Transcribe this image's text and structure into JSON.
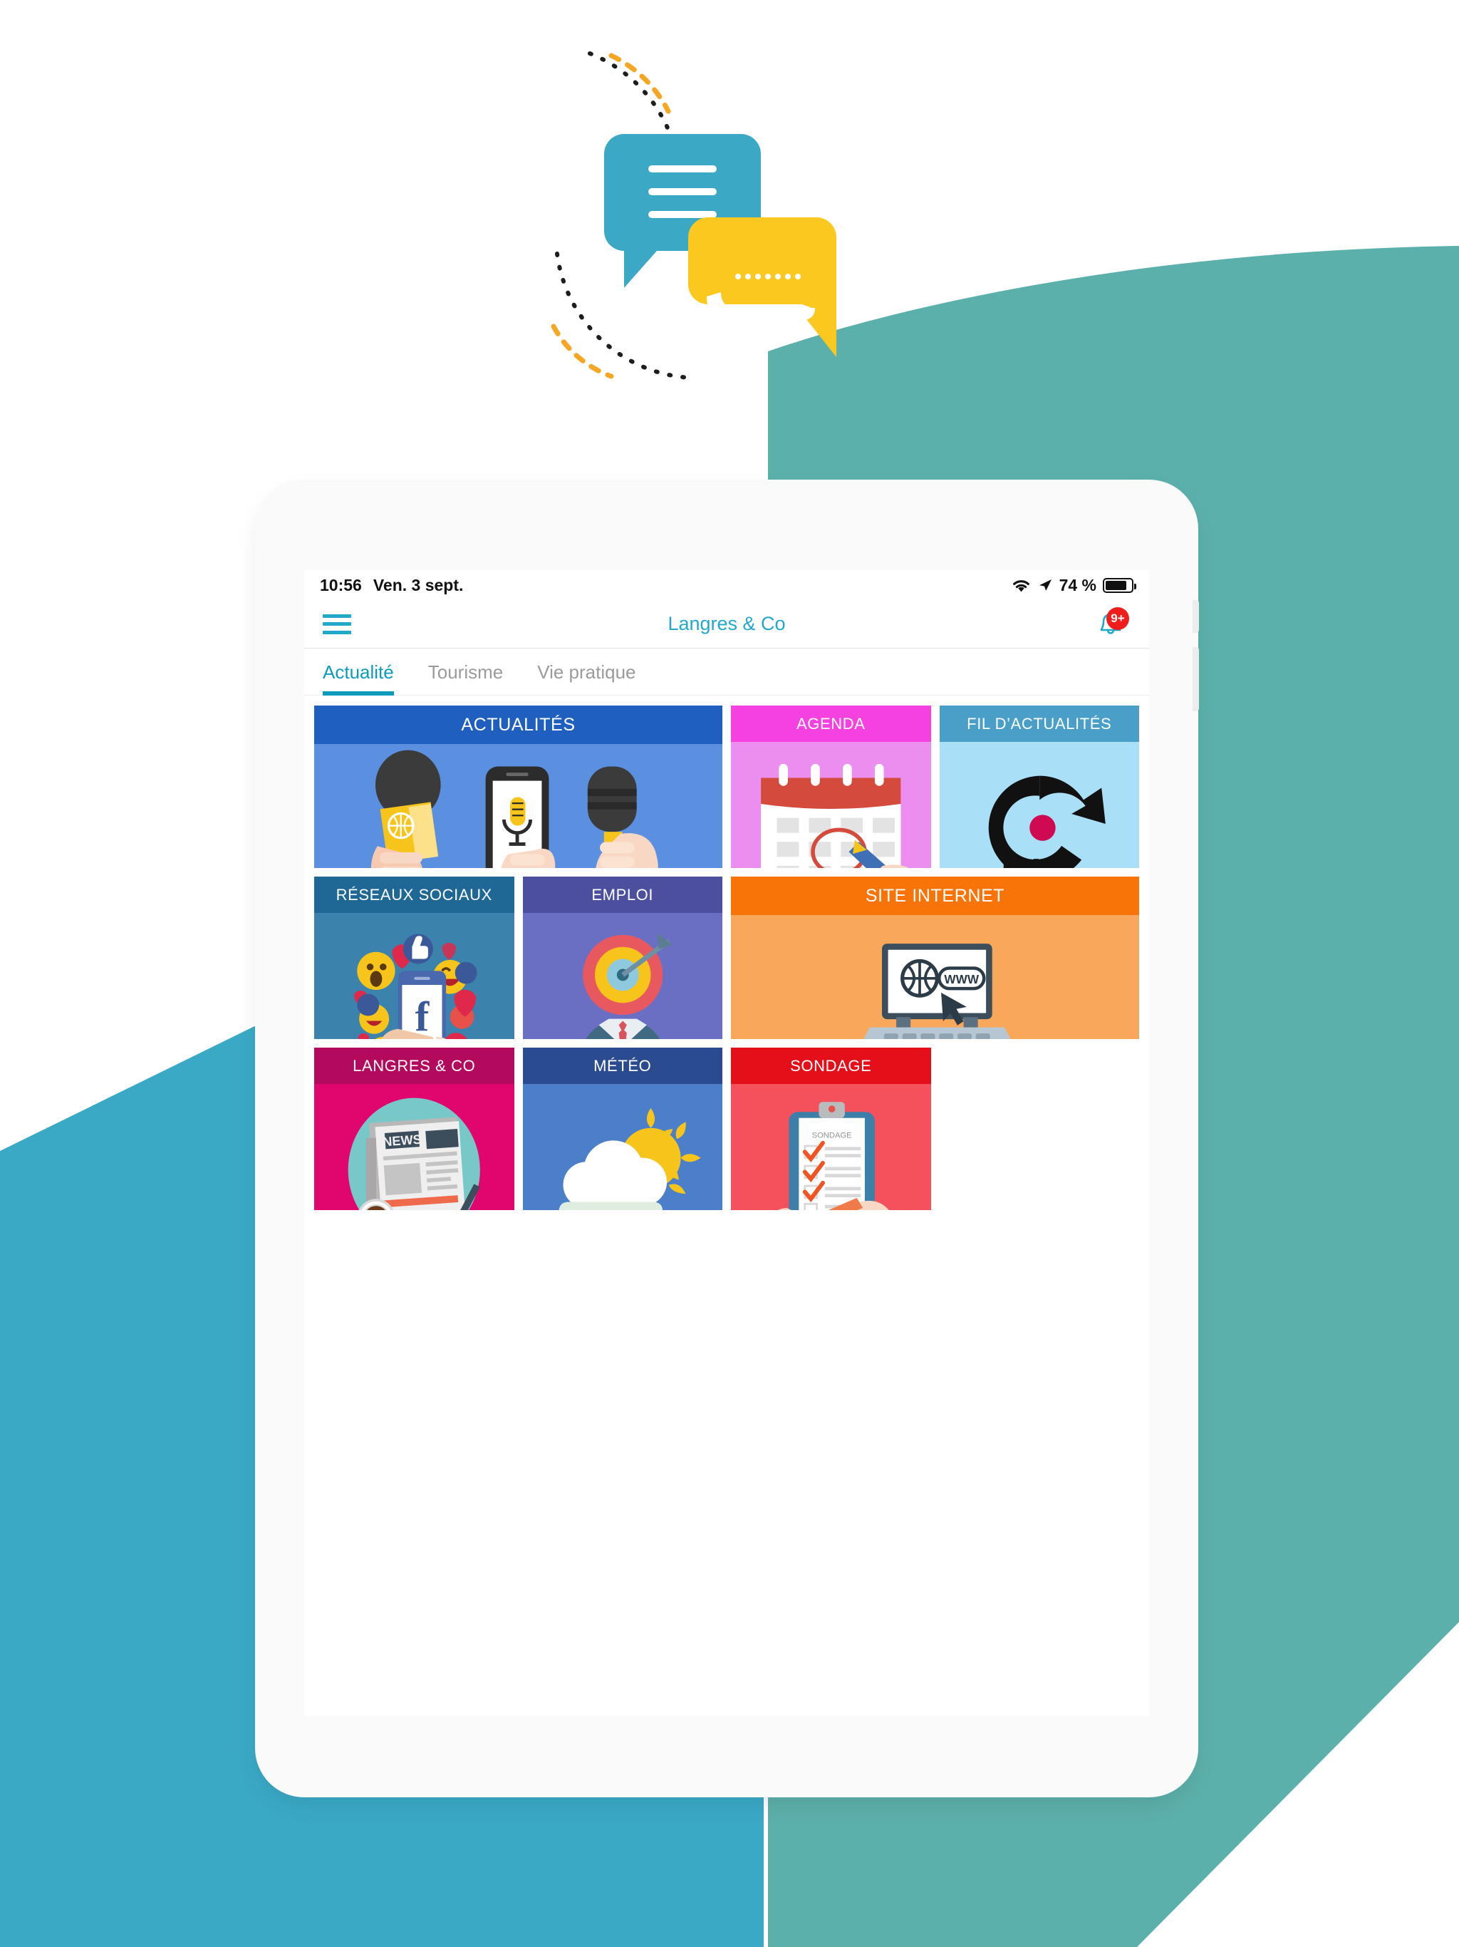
{
  "background": {
    "accent_left": "#3aa9c6",
    "accent_right": "#5cb0ab",
    "page_bg": "#ffffff"
  },
  "hero": {
    "name": "chat-bubbles-illustration",
    "bubble_primary_color": "#3ba9c6",
    "bubble_secondary_color": "#fbc81f",
    "dot_arc_colors": [
      "#1d1d1b",
      "#f5a623"
    ]
  },
  "device": {
    "name": "tablet-mockup",
    "frame_color": "#e9e9e9"
  },
  "statusbar": {
    "time": "10:56",
    "date": "Ven. 3 sept.",
    "wifi_icon": "wifi-icon",
    "location_icon": "location-arrow-icon",
    "battery_percent": "74 %",
    "battery_level": 74,
    "battery_icon": "battery-icon"
  },
  "appbar": {
    "menu_icon": "hamburger-menu-icon",
    "title": "Langres & Co",
    "title_color": "#22a8c9",
    "bell_icon": "notification-bell-icon",
    "badge_count": "9+",
    "badge_color": "#f01d1d"
  },
  "tabs": [
    {
      "label": "Actualité",
      "active": true
    },
    {
      "label": "Tourisme",
      "active": false
    },
    {
      "label": "Vie pratique",
      "active": false
    }
  ],
  "tiles": [
    {
      "label": "ACTUALITÉS",
      "icon": "microphones-reporters-icon",
      "header_color": "#1f5fc0",
      "body_color": "#5b8fe0",
      "span": 2,
      "row": 1
    },
    {
      "label": "AGENDA",
      "icon": "calendar-pen-icon",
      "header_color": "#f441e0",
      "body_color": "#eb8ef0",
      "span": 1,
      "row": 1
    },
    {
      "label": "FIL D’ACTUALITÉS",
      "icon": "centre-france-logo-icon",
      "header_color": "#4a9fc8",
      "body_color": "#a9e0f8",
      "span": 1,
      "row": 1
    },
    {
      "label": "RÉSEAUX SOCIAUX",
      "icon": "facebook-reactions-phone-icon",
      "header_color": "#1f6896",
      "body_color": "#3b82ad",
      "span": 1,
      "row": 2
    },
    {
      "label": "EMPLOI",
      "icon": "businessman-target-icon",
      "header_color": "#4b4f9e",
      "body_color": "#6b6fc4",
      "span": 1,
      "row": 2
    },
    {
      "label": "SITE INTERNET",
      "icon": "laptop-www-icon",
      "header_color": "#f97408",
      "body_color": "#f9a košice",
      "span": 2,
      "row": 2
    },
    {
      "label": "LANGRES & CO",
      "icon": "newspaper-coffee-icon",
      "header_color": "#b40a5e",
      "body_color": "#e0066e",
      "span": 1,
      "row": 3
    },
    {
      "label": "MÉTÉO",
      "icon": "sun-cloud-icon",
      "header_color": "#2b4b90",
      "body_color": "#4b7fc9",
      "span": 1,
      "row": 3
    },
    {
      "label": "SONDAGE",
      "icon": "clipboard-survey-icon",
      "header_color": "#e40f18",
      "body_color": "#f4515c",
      "span": 1,
      "row": 3
    }
  ]
}
